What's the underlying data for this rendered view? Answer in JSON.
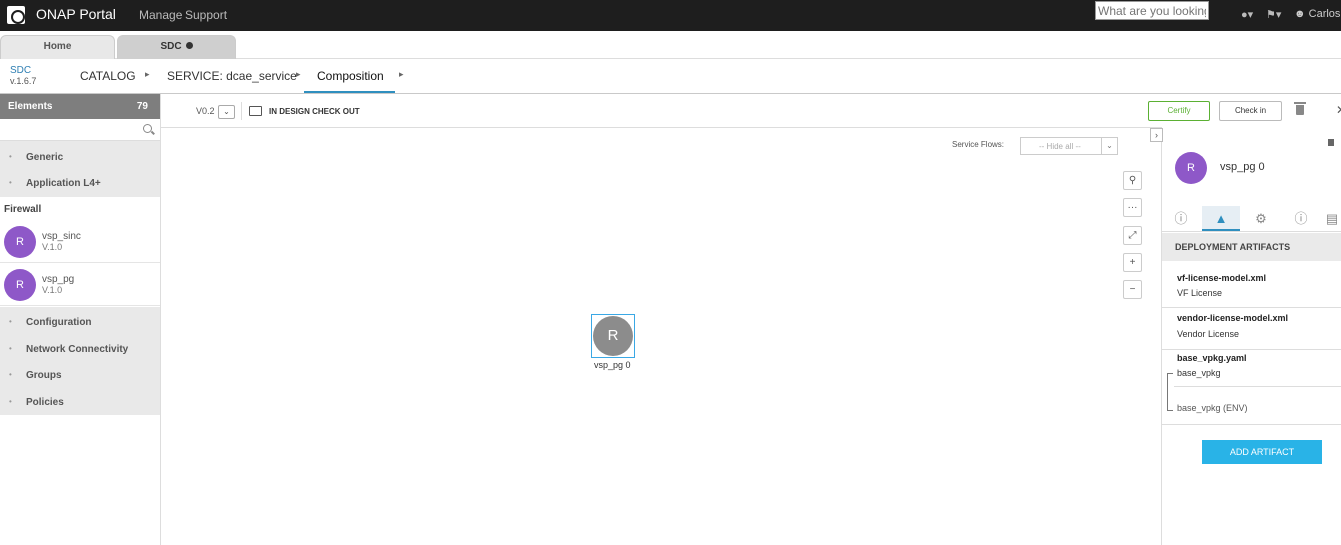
{
  "topbar": {
    "app_title": "ONAP Portal",
    "menu": [
      "Manage",
      "Support"
    ],
    "search_placeholder": "What are you looking for?",
    "user": "Carlos"
  },
  "tabs": [
    {
      "label": "Home"
    },
    {
      "label": "SDC"
    }
  ],
  "breadcrumb": {
    "brand": "SDC",
    "version": "v.1.6.7",
    "items": [
      "CATALOG",
      "SERVICE: dcae_service",
      "Composition"
    ]
  },
  "elements": {
    "title": "Elements",
    "count": "79",
    "categories_top": [
      "Generic",
      "Application L4+"
    ],
    "group_title": "Firewall",
    "components": [
      {
        "initial": "R",
        "name": "vsp_sinc",
        "version": "V.1.0"
      },
      {
        "initial": "R",
        "name": "vsp_pg",
        "version": "V.1.0"
      }
    ],
    "categories_bottom": [
      "Configuration",
      "Network Connectivity",
      "Groups",
      "Policies"
    ]
  },
  "toolbar": {
    "version": "V0.2",
    "status": "IN DESIGN CHECK OUT",
    "certify": "Certify",
    "checkin": "Check in"
  },
  "canvas": {
    "flows_label": "Service Flows:",
    "flows_value": "-- Hide all --",
    "node": {
      "initial": "R",
      "label": "vsp_pg 0"
    }
  },
  "right_panel": {
    "avatar_initial": "R",
    "name": "vsp_pg 0",
    "section_title": "DEPLOYMENT ARTIFACTS",
    "artifacts": [
      {
        "name": "vf-license-model.xml",
        "desc": "VF License"
      },
      {
        "name": "vendor-license-model.xml",
        "desc": "Vendor License"
      },
      {
        "name": "base_vpkg.yaml",
        "desc": "base_vpkg",
        "env": "base_vpkg (ENV)"
      }
    ],
    "add_button": "ADD ARTIFACT"
  },
  "colors": {
    "topbar": "#1e1e1e",
    "avatar": "#8e58c8",
    "accent": "#2f8fbf",
    "certify": "#5bb033",
    "add_artifact": "#29b3e7"
  }
}
